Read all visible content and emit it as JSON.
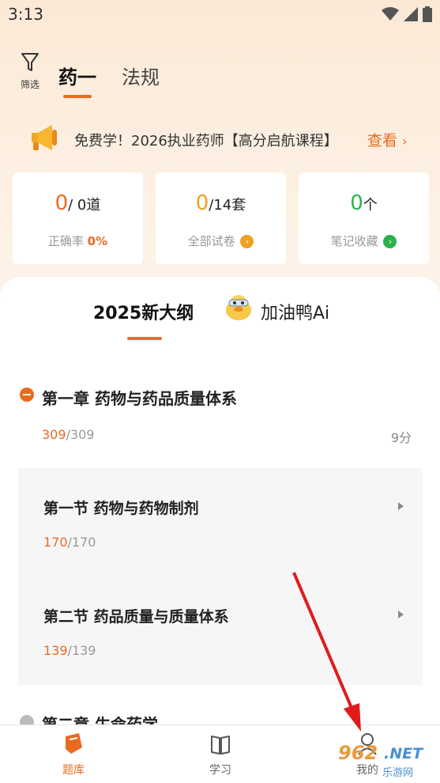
{
  "status_bar": {
    "time": "3:13"
  },
  "header": {
    "filter_label": "筛选",
    "tabs": [
      {
        "label": "药一",
        "active": true
      },
      {
        "label": "法规",
        "active": false
      }
    ]
  },
  "banner": {
    "text": "免费学！2026执业药师【高分启航课程】",
    "link_label": "查看"
  },
  "stats": [
    {
      "value": "0",
      "suffix": "/ 0道",
      "value_color": "#ea6a1f",
      "sub_label": "正确率",
      "sub_value": "0%"
    },
    {
      "value": "0",
      "suffix": "/14套",
      "value_color": "#f0a020",
      "sub_label": "全部试卷",
      "badge_color": "#f0a020"
    },
    {
      "value": "0",
      "suffix": "个",
      "value_color": "#2ab34a",
      "sub_label": "笔记收藏",
      "badge_color": "#2ab34a"
    }
  ],
  "segments": [
    {
      "label": "2025新大纲",
      "active": true
    },
    {
      "label": "加油鸭Ai",
      "active": false
    }
  ],
  "chapter": {
    "title": "第一章 药物与药品质量体系",
    "done": "309",
    "total": "/309",
    "score": "9分",
    "sections": [
      {
        "title": "第一节 药物与药物制剂",
        "done": "170",
        "total": "/170"
      },
      {
        "title": "第二节 药品质量与质量体系",
        "done": "139",
        "total": "/139"
      }
    ]
  },
  "next_chapter": {
    "title": "第二章 生命药学"
  },
  "bottom_nav": [
    {
      "label": "题库",
      "active": true
    },
    {
      "label": "学习",
      "active": false
    },
    {
      "label": "我的",
      "active": false
    }
  ],
  "watermark": {
    "num": "962",
    "net": ".NET",
    "name": "乐游网"
  },
  "colors": {
    "accent": "#ea6a1f",
    "orange_badge": "#f0a020",
    "green": "#2ab34a",
    "annotation_arrow": "#e01b1b"
  }
}
